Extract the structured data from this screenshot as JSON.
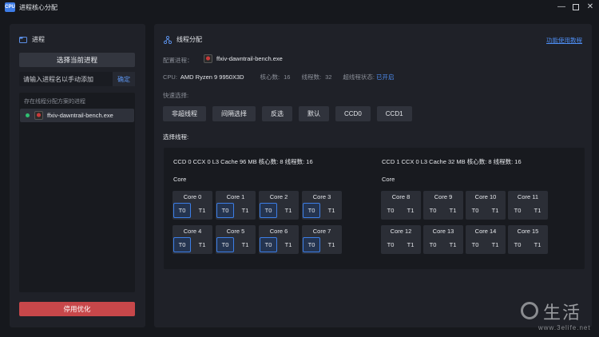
{
  "app": {
    "logo_text": "CPU",
    "title": "进程核心分配"
  },
  "window": {
    "minimize": "—",
    "close": "✕"
  },
  "left": {
    "header": "进程",
    "select_current_btn": "选择当前进程",
    "search_placeholder": "请输入进程名以手动添加",
    "confirm_btn": "确定",
    "list_label": "存在线程分配方案的进程",
    "processes": [
      {
        "name": "ffxiv-dawntrail-bench.exe",
        "status": "running"
      }
    ],
    "stop_btn": "停用优化"
  },
  "right": {
    "header": "线程分配",
    "help_link": "功能使用教程",
    "config_label": "配置进程：",
    "config_process": "ffxiv-dawntrail-bench.exe",
    "cpu_label": "CPU:",
    "cpu_name": "AMD Ryzen 9 9950X3D",
    "cores_label": "核心数:",
    "cores_value": "16",
    "threads_label": "线程数:",
    "threads_value": "32",
    "ht_label": "超线程状态:",
    "ht_value": "已开启",
    "quick_label": "快速选择:",
    "quick_buttons": [
      "非超线程",
      "间隔选择",
      "反选",
      "默认",
      "CCD0",
      "CCD1"
    ],
    "select_threads_label": "选择线程:",
    "ccds": [
      {
        "info": "CCD 0 CCX 0   L3 Cache   96 MB   核心数:  8   线程数:   16",
        "core_label": "Core",
        "cores": [
          {
            "name": "Core 0",
            "t0": "T0",
            "t1": "T1"
          },
          {
            "name": "Core 1",
            "t0": "T0",
            "t1": "T1"
          },
          {
            "name": "Core 2",
            "t0": "T0",
            "t1": "T1"
          },
          {
            "name": "Core 3",
            "t0": "T0",
            "t1": "T1"
          },
          {
            "name": "Core 4",
            "t0": "T0",
            "t1": "T1"
          },
          {
            "name": "Core 5",
            "t0": "T0",
            "t1": "T1"
          },
          {
            "name": "Core 6",
            "t0": "T0",
            "t1": "T1"
          },
          {
            "name": "Core 7",
            "t0": "T0",
            "t1": "T1"
          }
        ]
      },
      {
        "info": "CCD 1 CCX 0   L3 Cache   32 MB   核心数:  8   线程数:   16",
        "core_label": "Core",
        "cores": [
          {
            "name": "Core 8",
            "t0": "T0",
            "t1": "T1"
          },
          {
            "name": "Core 9",
            "t0": "T0",
            "t1": "T1"
          },
          {
            "name": "Core 10",
            "t0": "T0",
            "t1": "T1"
          },
          {
            "name": "Core 11",
            "t0": "T0",
            "t1": "T1"
          },
          {
            "name": "Core 12",
            "t0": "T0",
            "t1": "T1"
          },
          {
            "name": "Core 13",
            "t0": "T0",
            "t1": "T1"
          },
          {
            "name": "Core 14",
            "t0": "T0",
            "t1": "T1"
          },
          {
            "name": "Core 15",
            "t0": "T0",
            "t1": "T1"
          }
        ]
      }
    ],
    "selected_threads": [
      "Core 0 T0",
      "Core 1 T0",
      "Core 2 T0",
      "Core 3 T0",
      "Core 4 T0",
      "Core 5 T0",
      "Core 6 T0",
      "Core 7 T0"
    ]
  },
  "watermark": {
    "text": "生活",
    "url": "www.3elife.net"
  },
  "colors": {
    "accent": "#3c7ee6",
    "danger": "#c7474a",
    "running": "#2fbf71",
    "panel": "#1f2128"
  }
}
